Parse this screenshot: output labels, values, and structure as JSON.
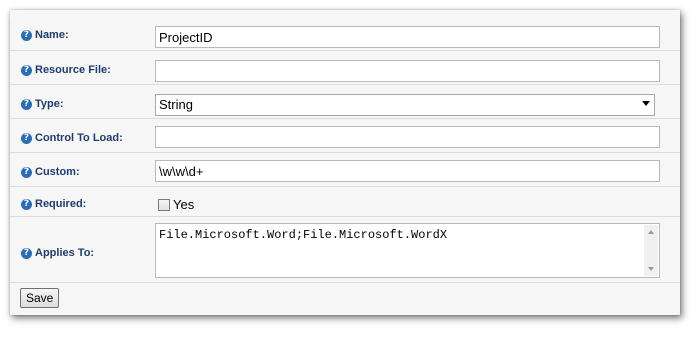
{
  "form": {
    "fields": [
      {
        "label": "Name:",
        "value": "ProjectID"
      },
      {
        "label": "Resource File:",
        "value": ""
      },
      {
        "label": "Type:",
        "value": "String"
      },
      {
        "label": "Control To Load:",
        "value": ""
      },
      {
        "label": "Custom:",
        "value": "\\w\\w\\d+"
      },
      {
        "label": "Required:",
        "checkbox_label": "Yes",
        "checked": false
      },
      {
        "label": "Applies To:",
        "value": "File.Microsoft.Word;File.Microsoft.WordX"
      }
    ],
    "save_label": "Save"
  },
  "icons": {
    "help": "help-icon"
  },
  "colors": {
    "label": "#1f3d6b",
    "help_icon": "#2b6db3"
  }
}
